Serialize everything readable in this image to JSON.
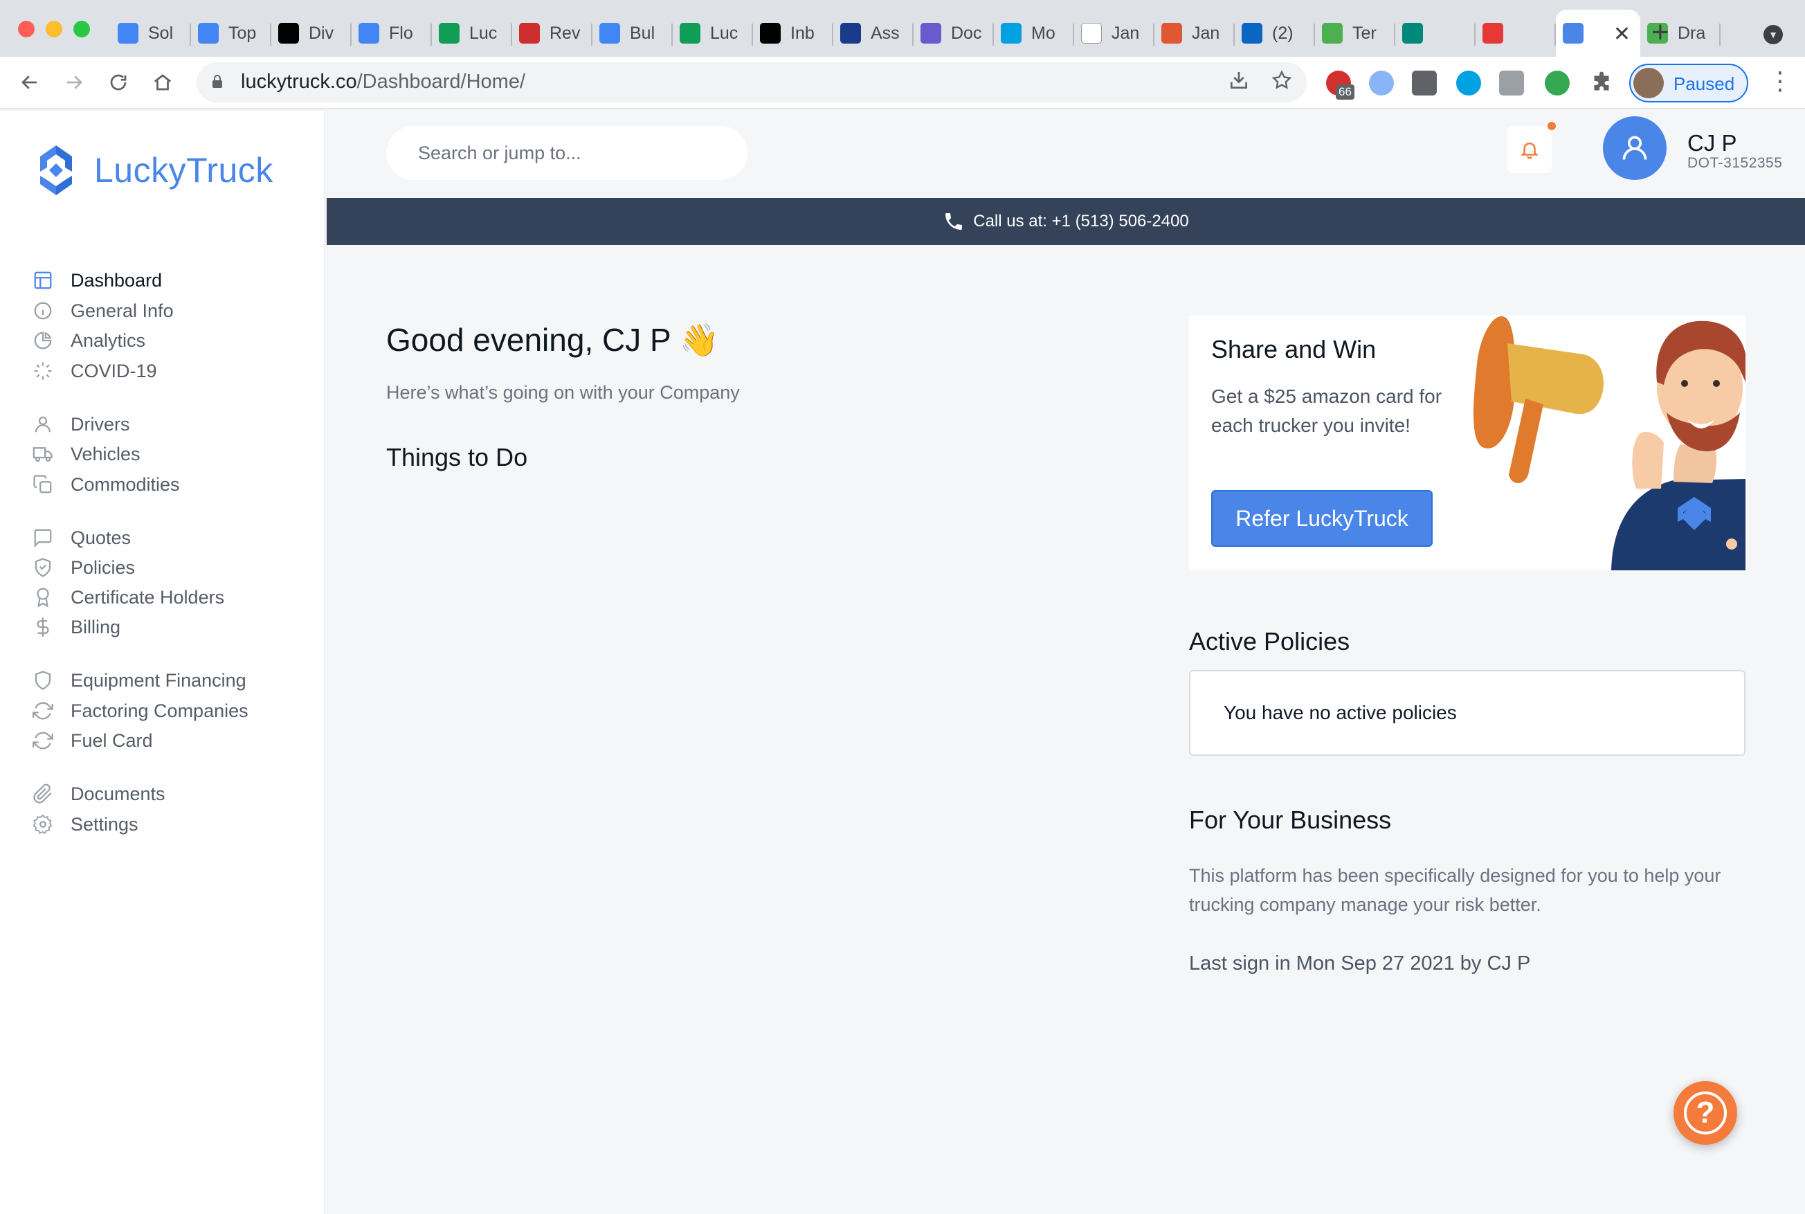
{
  "browser": {
    "tabs": [
      {
        "label": "Sol",
        "icon": "google-docs-icon",
        "color": "#4285f4"
      },
      {
        "label": "Top",
        "icon": "google-docs-icon",
        "color": "#4285f4"
      },
      {
        "label": "Div",
        "icon": "medium-icon",
        "color": "#000000"
      },
      {
        "label": "Flo",
        "icon": "google-docs-icon",
        "color": "#4285f4"
      },
      {
        "label": "Luc",
        "icon": "google-sheets-icon",
        "color": "#0f9d58"
      },
      {
        "label": "Rev",
        "icon": "colorado-icon",
        "color": "#cf2e2e"
      },
      {
        "label": "Bul",
        "icon": "google-docs-icon",
        "color": "#4285f4"
      },
      {
        "label": "Luc",
        "icon": "google-sheets-icon",
        "color": "#0f9d58"
      },
      {
        "label": "Inb",
        "icon": "calendar-31-icon",
        "color": "#000000"
      },
      {
        "label": "Ass",
        "icon": "podcast-icon",
        "color": "#1a3a8a"
      },
      {
        "label": "Doc",
        "icon": "circle-logo-icon",
        "color": "#6a5acd"
      },
      {
        "label": "Mo",
        "icon": "salesforce-icon",
        "color": "#00a1e0"
      },
      {
        "label": "Jan",
        "icon": "wikipedia-icon",
        "color": "#ffffff"
      },
      {
        "label": "Jan",
        "icon": "duckduckgo-icon",
        "color": "#de5833"
      },
      {
        "label": "(2)",
        "icon": "linkedin-icon",
        "color": "#0a66c2"
      },
      {
        "label": "Ter",
        "icon": "stack-icon",
        "color": "#4caf50"
      },
      {
        "label": "",
        "icon": "google-meet-icon",
        "color": "#00897b"
      },
      {
        "label": "",
        "icon": "record-icon",
        "color": "#e53935"
      },
      {
        "label": "",
        "icon": "luckytruck-icon",
        "color": "#4a86e8",
        "active": true
      },
      {
        "label": "Dra",
        "icon": "stack-icon",
        "color": "#4caf50"
      }
    ],
    "url_host": "luckytruck.co",
    "url_path": "/Dashboard/Home/",
    "extension_badge": "66",
    "profile_label": "Paused"
  },
  "brand": {
    "name": "LuckyTruck",
    "accent": "#4a86e8",
    "dark": "#34435a",
    "orange": "#f47b3b"
  },
  "sidebar": {
    "items": [
      {
        "label": "Dashboard",
        "icon": "layout-icon",
        "active": true
      },
      {
        "label": "General Info",
        "icon": "info-icon"
      },
      {
        "label": "Analytics",
        "icon": "pie-chart-icon"
      },
      {
        "label": "COVID-19",
        "icon": "loader-icon"
      },
      {
        "label": "Drivers",
        "icon": "user-icon"
      },
      {
        "label": "Vehicles",
        "icon": "truck-icon"
      },
      {
        "label": "Commodities",
        "icon": "copy-icon"
      },
      {
        "label": "Quotes",
        "icon": "message-square-icon"
      },
      {
        "label": "Policies",
        "icon": "shield-check-icon"
      },
      {
        "label": "Certificate Holders",
        "icon": "award-icon"
      },
      {
        "label": "Billing",
        "icon": "dollar-sign-icon"
      },
      {
        "label": "Equipment Financing",
        "icon": "shield-icon"
      },
      {
        "label": "Factoring Companies",
        "icon": "refresh-icon"
      },
      {
        "label": "Fuel Card",
        "icon": "refresh-icon"
      },
      {
        "label": "Documents",
        "icon": "paperclip-icon"
      },
      {
        "label": "Settings",
        "icon": "settings-icon"
      }
    ]
  },
  "header": {
    "search_placeholder": "Search or jump to...",
    "user_name": "CJ P",
    "user_dot": "DOT-3152355"
  },
  "callbar": {
    "text": "Call us at: +1 (513) 506-2400"
  },
  "main": {
    "greeting": "Good evening, CJ P 👋",
    "subtext": "Here’s what’s going on with your Company",
    "things_to_do": "Things to Do",
    "share": {
      "title": "Share and Win",
      "description": "Get a $25 amazon card for each trucker you invite!",
      "button": "Refer LuckyTruck"
    },
    "active_policies": {
      "title": "Active Policies",
      "empty": "You have no active policies"
    },
    "business": {
      "title": "For Your Business",
      "description": "This platform has been specifically designed for you to help your trucking company manage your risk better.",
      "last_sign_in": "Last sign in Mon Sep 27 2021 by CJ P"
    },
    "help_icon": "?"
  }
}
